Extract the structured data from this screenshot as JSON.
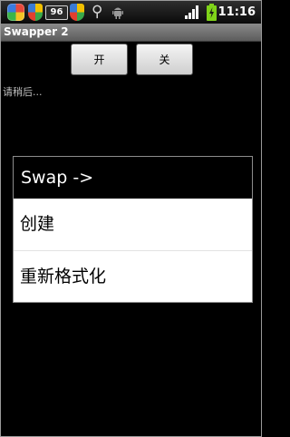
{
  "status_bar": {
    "badge": "96",
    "time": "11:16",
    "icons": [
      "app-icon",
      "shield-icon",
      "shield-icon",
      "usb-icon",
      "android-debug-icon",
      "signal-icon",
      "battery-charging-icon"
    ],
    "colors": {
      "battery": "#7fd319",
      "signal": "#ffffff"
    }
  },
  "app": {
    "title": "Swapper 2"
  },
  "toolbar": {
    "on_label": "开",
    "off_label": "关"
  },
  "status": {
    "message": "请稍后..."
  },
  "dialog": {
    "title": "Swap ->",
    "items": [
      {
        "label": "创建"
      },
      {
        "label": "重新格式化"
      }
    ]
  }
}
